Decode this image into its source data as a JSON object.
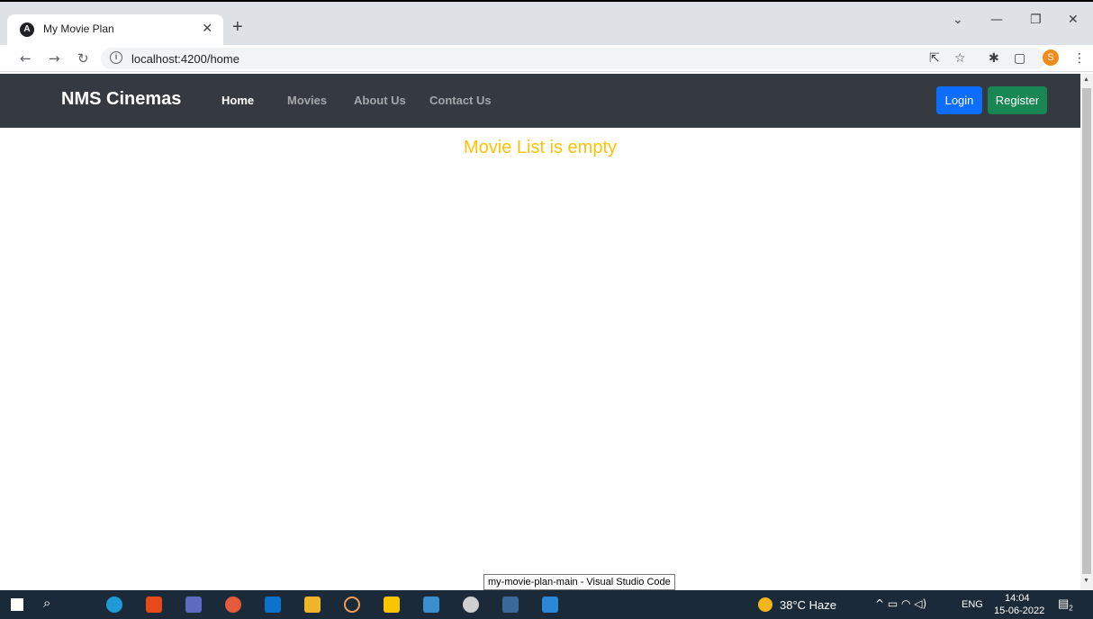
{
  "browser": {
    "tab_title": "My Movie Plan",
    "tab_favicon": "A",
    "url": "localhost:4200/home",
    "profile_initial": "S"
  },
  "navbar": {
    "brand": "NMS Cinemas",
    "links": [
      "Home",
      "Movies",
      "About Us",
      "Contact Us"
    ],
    "active_link": "Home",
    "login_label": "Login",
    "register_label": "Register"
  },
  "main": {
    "empty_message": "Movie List is empty"
  },
  "tooltip": {
    "text": "my-movie-plan-main - Visual Studio Code"
  },
  "taskbar": {
    "weather": "38°C  Haze",
    "language": "ENG",
    "time": "14:04",
    "date": "15-06-2022",
    "notification_count": "2"
  },
  "colors": {
    "navbar_bg": "#343a40",
    "login_btn": "#0d6efd",
    "register_btn": "#198754",
    "empty_message": "#ffc107"
  }
}
